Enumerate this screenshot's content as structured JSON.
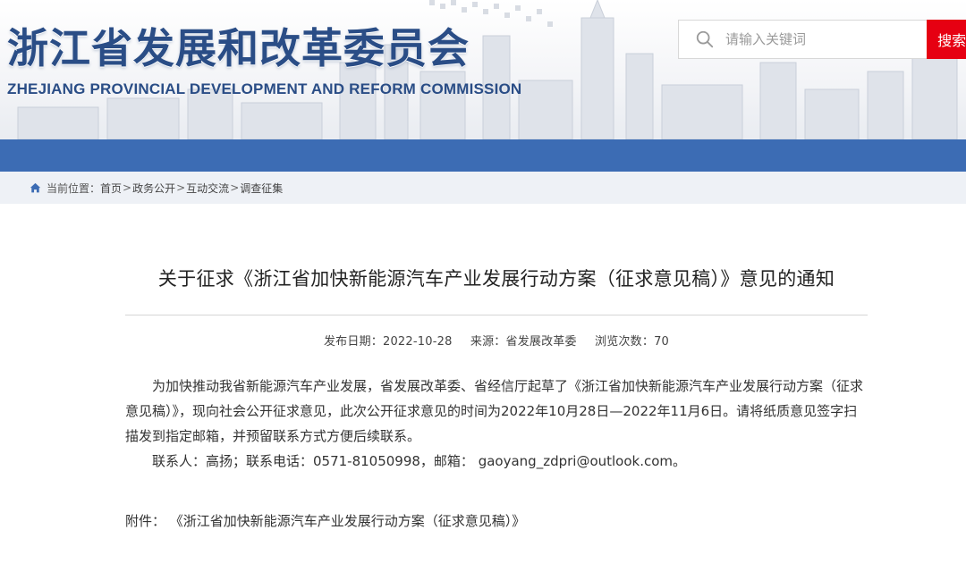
{
  "header": {
    "site_title": "浙江省发展和改革委员会",
    "site_subtitle": "ZHEJIANG PROVINCIAL DEVELOPMENT AND REFORM COMMISSION"
  },
  "search": {
    "placeholder": "请输入关键词",
    "button_label": "搜索"
  },
  "breadcrumb": {
    "prefix": "当前位置：",
    "items": [
      "首页",
      "政务公开",
      "互动交流",
      "调查征集"
    ],
    "separator": ">"
  },
  "article": {
    "title": "关于征求《浙江省加快新能源汽车产业发展行动方案（征求意见稿）》意见的通知",
    "meta": {
      "date_label": "发布日期：",
      "date": "2022-10-28",
      "source_label": "来源：",
      "source": "省发展改革委",
      "views_label": "浏览次数：",
      "views": "70"
    },
    "paragraph1": "为加快推动我省新能源汽车产业发展，省发展改革委、省经信厅起草了《浙江省加快新能源汽车产业发展行动方案（征求意见稿）》，现向社会公开征求意见，此次公开征求意见的时间为2022年10月28日—2022年11月6日。请将纸质意见签字扫描发到指定邮箱，并预留联系方式方便后续联系。",
    "contact": "联系人：高扬；联系电话：0571-81050998，邮箱：  gaoyang_zdpri@outlook.com。",
    "attachment_label": "附件：",
    "attachment_link": "《浙江省加快新能源汽车产业发展行动方案（征求意见稿）》"
  },
  "colors": {
    "brand_blue": "#2a4d86",
    "nav_blue": "#3c6cb4",
    "search_red": "#e60012",
    "breadcrumb_bg": "#eef1f6"
  },
  "icons": {
    "search": "search-icon",
    "home": "home-icon"
  }
}
